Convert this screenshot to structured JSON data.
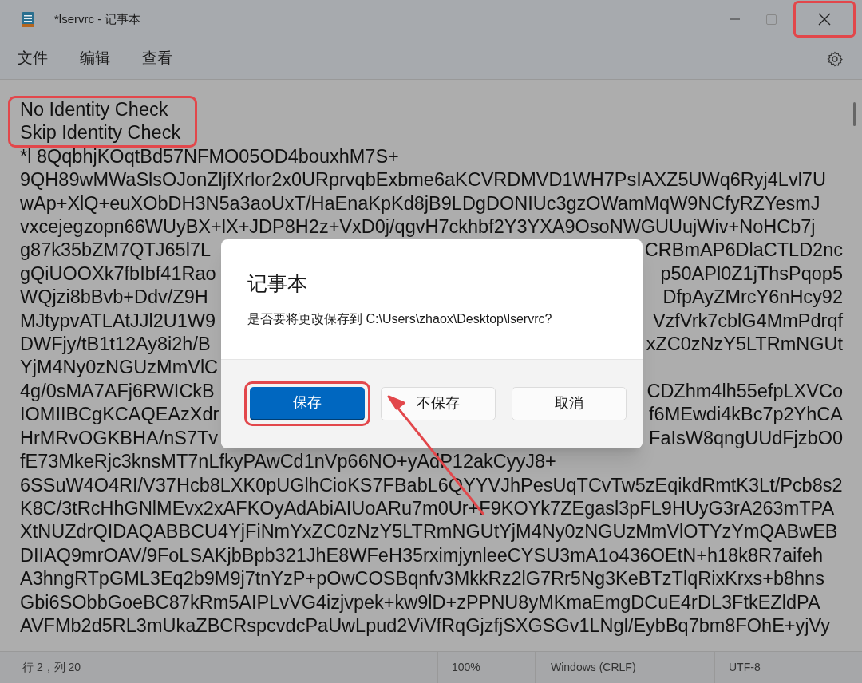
{
  "window": {
    "title": "*lservrc - 记事本",
    "close_highlighted": true
  },
  "menu": [
    "文件",
    "编辑",
    "查看"
  ],
  "editor": {
    "marked_block": {
      "highlighted": true,
      "lines": [
        "No Identity Check",
        "Skip Identity Check"
      ]
    },
    "lines": [
      {
        "text": "*l 8QqbhjKOqtBd57NFMO05OD4bouxhM7S+"
      },
      {
        "text": "9QH89wMWaSlsOJonZljfXrlor2x0URprvqbExbme6aKCVRDMVD1WH7PsIAXZ5UWq6Ryj4Lvl7U"
      },
      {
        "text": "wAp+XlQ+euXObDH3N5a3aoUxT/HaEnaKpKd8jB9LDgDONIUc3gzOWamMqW9NCfyRZYesmJ"
      },
      {
        "text": "vxcejegzopn66WUyBX+lX+JDP8H2z+VxD0j/qgvH7ckhbf2Y3YXA9OsoNWGUUujWiv+NoHCb7j"
      },
      {
        "start": "g87k35bZM7QTJ65l7L",
        "end": "CRBmAP6DlaCTLD2nc"
      },
      {
        "start": "gQiUOOXk7fbIbf41Rao",
        "end": "p50APl0Z1jThsPqop5"
      },
      {
        "start": "WQjzi8bBvb+Ddv/Z9H",
        "end": "DfpAyZMrcY6nHcy92"
      },
      {
        "start": "MJtypvATLAtJJl2U1W9",
        "end": "VzfVrk7cblG4MmPdrqf"
      },
      {
        "start": "DWFjy/tB1t12Ay8i2h/B",
        "end": "xZC0zNzY5LTRmNGUt"
      },
      {
        "start": "YjM4Ny0zNGUzMmVlC"
      },
      {
        "start": "4g/0sMA7AFj6RWICkB",
        "end": "CDZhm4lh55efpLXVCo"
      },
      {
        "start": "IOMIIBCgKCAQEAzXdr",
        "end": "f6MEwdi4kBc7p2YhCA"
      },
      {
        "start": "HrMRvOGKBHA/nS7Tv",
        "end": "FaIsW8qngUUdFjzbO0"
      },
      {
        "text": "fE73MkeRjc3knsMT7nLfkyPAwCd1nVp66NO+yAdP12akCyyJ8+"
      },
      {
        "text": "6SSuW4O4RI/V37Hcb8LXK0pUGlhCioKS7FBabL6QYYVJhPesUqTCvTw5zEqikdRmtK3Lt/Pcb8s2"
      },
      {
        "text": "K8C/3tRcHhGNlMEvx2xAFKOyAdAbiAIUoARu7m0Ur+F9KOYk7ZEgasl3pFL9HUyG3rA263mTPA"
      },
      {
        "text": "XtNUZdrQIDAQABBCU4YjFiNmYxZC0zNzY5LTRmNGUtYjM4Ny0zNGUzMmVlOTYzYmQABwEB"
      },
      {
        "text": "DIIAQ9mrOAV/9FoLSAKjbBpb321JhE8WFeH35rximjynleeCYSU3mA1o436OEtN+h18k8R7aifeh"
      },
      {
        "text": "A3hngRTpGML3Eq2b9M9j7tnYzP+pOwCOSBqnfv3MkkRz2lG7Rr5Ng3KeBTzTlqRixKrxs+b8hns"
      },
      {
        "text": "Gbi6SObbGoeBC87kRm5AIPLvVG4izjvpek+kw9lD+zPPNU8yMKmaEmgDCuE4rDL3FtkEZldPA"
      },
      {
        "text": "AVFMb2d5RL3mUkaZBCRspcvdcPaUwLpud2ViVfRqGjzfjSXGSGv1LNgl/EybBq7bm8FOhE+yjVy"
      }
    ]
  },
  "dialog": {
    "title": "记事本",
    "message": "是否要将更改保存到 C:\\Users\\zhaox\\Desktop\\lservrc?",
    "buttons": [
      {
        "label": "保存",
        "kind": "primary",
        "highlighted": true
      },
      {
        "label": "不保存",
        "kind": "secondary",
        "highlighted": false
      },
      {
        "label": "取消",
        "kind": "secondary",
        "highlighted": false
      }
    ]
  },
  "annotation_arrow": true,
  "status_bar": [
    "行 2，列 20",
    "100%",
    "Windows (CRLF)",
    "UTF-8"
  ]
}
